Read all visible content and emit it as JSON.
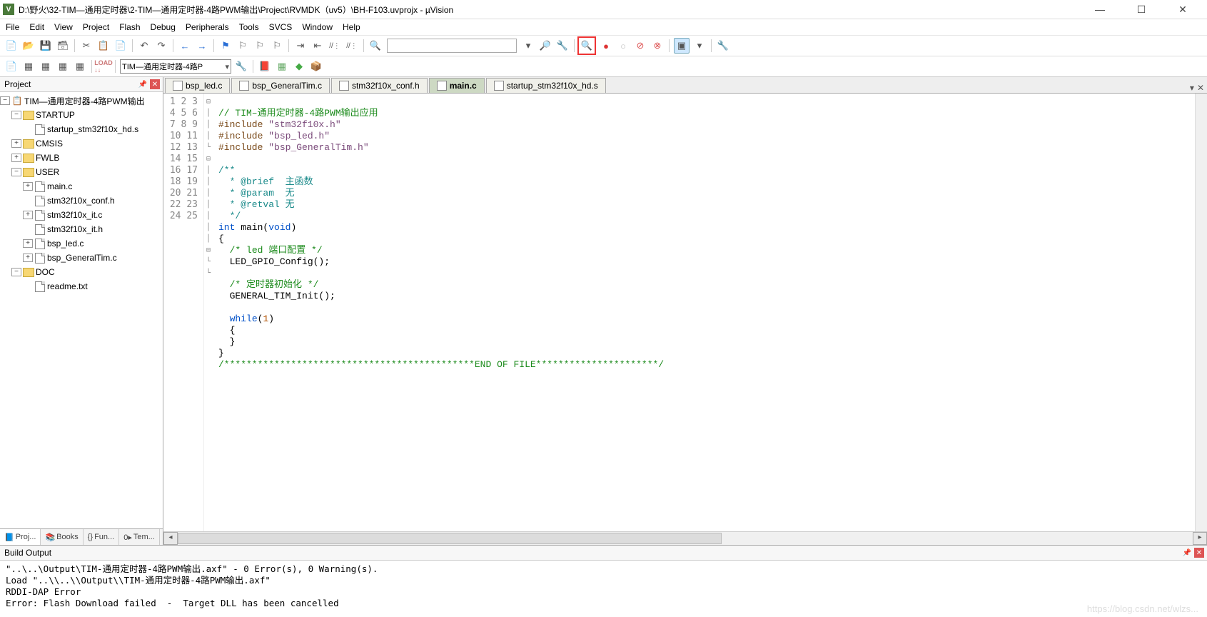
{
  "window": {
    "title": "D:\\野火\\32-TIM—通用定时器\\2-TIM—通用定时器-4路PWM输出\\Project\\RVMDK（uv5）\\BH-F103.uvprojx - µVision"
  },
  "menu": [
    "File",
    "Edit",
    "View",
    "Project",
    "Flash",
    "Debug",
    "Peripherals",
    "Tools",
    "SVCS",
    "Window",
    "Help"
  ],
  "target_combo": "TIM—通用定时器-4路P",
  "project_pane": {
    "title": "Project",
    "root": "TIM—通用定时器-4路PWM输出",
    "groups": [
      {
        "name": "STARTUP",
        "expanded": true,
        "files": [
          "startup_stm32f10x_hd.s"
        ]
      },
      {
        "name": "CMSIS",
        "expanded": false,
        "files": []
      },
      {
        "name": "FWLB",
        "expanded": false,
        "files": []
      },
      {
        "name": "USER",
        "expanded": true,
        "files": [
          "main.c",
          "stm32f10x_conf.h",
          "stm32f10x_it.c",
          "stm32f10x_it.h",
          "bsp_led.c",
          "bsp_GeneralTim.c"
        ]
      },
      {
        "name": "DOC",
        "expanded": true,
        "files": [
          "readme.txt"
        ]
      }
    ],
    "tabs": [
      "Proj...",
      "Books",
      "Fun...",
      "Tem..."
    ],
    "tab_icons": [
      "📘",
      "📚",
      "{}",
      "0▸"
    ]
  },
  "file_tabs": [
    {
      "label": "bsp_led.c",
      "active": false,
      "close": true
    },
    {
      "label": "bsp_GeneralTim.c",
      "active": false,
      "close": true
    },
    {
      "label": "stm32f10x_conf.h",
      "active": false,
      "close": true
    },
    {
      "label": "main.c",
      "active": true,
      "close": true
    },
    {
      "label": "startup_stm32f10x_hd.s",
      "active": false,
      "close": true
    }
  ],
  "code": {
    "lines": [
      {
        "n": 1,
        "fold": "",
        "html": ""
      },
      {
        "n": 2,
        "fold": "",
        "html": "<span class='c-comment'>// TIM–通用定时器-4路PWM输出应用</span>"
      },
      {
        "n": 3,
        "fold": "",
        "html": "<span class='c-pp'>#include </span><span class='c-ppval'>\"stm32f10x.h\"</span>"
      },
      {
        "n": 4,
        "fold": "",
        "html": "<span class='c-pp'>#include </span><span class='c-ppval'>\"bsp_led.h\"</span>"
      },
      {
        "n": 5,
        "fold": "",
        "html": "<span class='c-pp'>#include </span><span class='c-ppval'>\"bsp_GeneralTim.h\"</span>"
      },
      {
        "n": 6,
        "fold": "",
        "html": ""
      },
      {
        "n": 7,
        "fold": "⊟",
        "html": "<span class='c-doc'>/**</span>"
      },
      {
        "n": 8,
        "fold": "│",
        "html": "<span class='c-doc'>  * @brief  主函数</span>"
      },
      {
        "n": 9,
        "fold": "│",
        "html": "<span class='c-doc'>  * @param  无</span>"
      },
      {
        "n": 10,
        "fold": "│",
        "html": "<span class='c-doc'>  * @retval 无</span>"
      },
      {
        "n": 11,
        "fold": "└",
        "html": "<span class='c-doc'>  */</span>"
      },
      {
        "n": 12,
        "fold": "",
        "html": "<span class='c-kw'>int</span> main(<span class='c-kw'>void</span>)"
      },
      {
        "n": 13,
        "fold": "⊟",
        "html": "{"
      },
      {
        "n": 14,
        "fold": "│",
        "html": "  <span class='c-comment'>/* led 端口配置 */</span>"
      },
      {
        "n": 15,
        "fold": "│",
        "html": "  LED_GPIO_Config();"
      },
      {
        "n": 16,
        "fold": "│",
        "html": ""
      },
      {
        "n": 17,
        "fold": "│",
        "html": "  <span class='c-comment'>/* 定时器初始化 */</span>"
      },
      {
        "n": 18,
        "fold": "│",
        "html": "  GENERAL_TIM_Init();"
      },
      {
        "n": 19,
        "fold": "│",
        "html": ""
      },
      {
        "n": 20,
        "fold": "│",
        "html": "  <span class='c-kw'>while</span>(<span class='c-num'>1</span>)"
      },
      {
        "n": 21,
        "fold": "⊟",
        "html": "  {"
      },
      {
        "n": 22,
        "fold": "└",
        "html": "  }"
      },
      {
        "n": 23,
        "fold": "└",
        "html": "}"
      },
      {
        "n": 24,
        "fold": "",
        "html": "<span class='c-comment'>/*********************************************END OF FILE**********************/</span>"
      },
      {
        "n": 25,
        "fold": "",
        "html": ""
      }
    ]
  },
  "build_output": {
    "title": "Build Output",
    "lines": [
      "\"..\\..\\Output\\TIM-通用定时器-4路PWM输出.axf\" - 0 Error(s), 0 Warning(s).",
      "Load \"..\\\\..\\\\Output\\\\TIM-通用定时器-4路PWM输出.axf\"",
      "RDDI-DAP Error",
      "Error: Flash Download failed  -  Target DLL has been cancelled"
    ]
  },
  "watermark": "https://blog.csdn.net/wlzs..."
}
